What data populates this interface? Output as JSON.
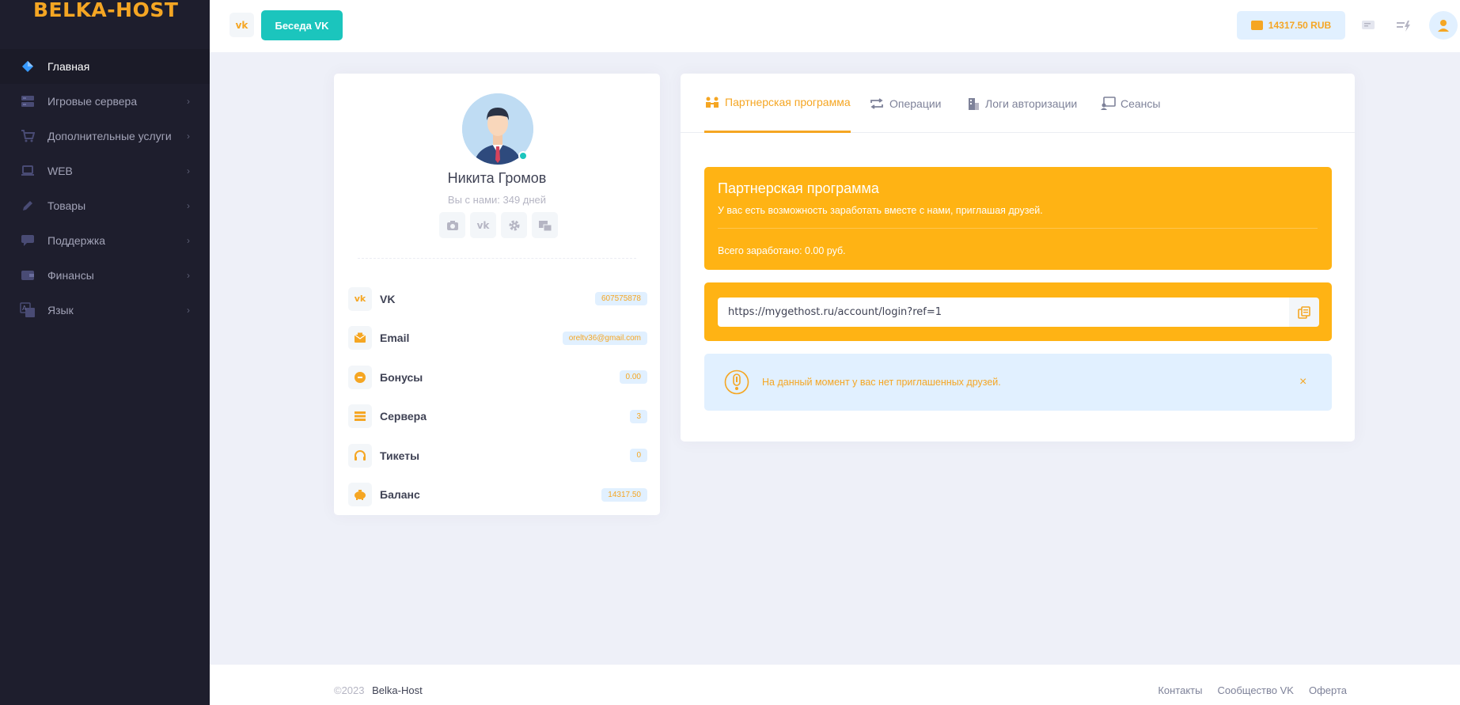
{
  "brand": {
    "logo": "BELKA-HOST"
  },
  "sidebar": {
    "items": [
      {
        "label": "Главная",
        "icon": "diamond-icon",
        "active": true
      },
      {
        "label": "Игровые сервера",
        "icon": "server-icon"
      },
      {
        "label": "Дополнительные услуги",
        "icon": "cart-icon"
      },
      {
        "label": "WEB",
        "icon": "laptop-icon"
      },
      {
        "label": "Товары",
        "icon": "pencil-icon"
      },
      {
        "label": "Поддержка",
        "icon": "chat-icon"
      },
      {
        "label": "Финансы",
        "icon": "wallet-icon"
      },
      {
        "label": "Язык",
        "icon": "translate-icon"
      }
    ]
  },
  "header": {
    "chat_button": "Беседа VK",
    "balance": "14317.50 RUB"
  },
  "profile": {
    "name": "Никита Громов",
    "since": "Вы с нами: 349 дней",
    "rows": [
      {
        "label": "VK",
        "value": "607575878",
        "icon": "vk-icon"
      },
      {
        "label": "Email",
        "value": "oreltv36@gmail.com",
        "icon": "email-icon"
      },
      {
        "label": "Бонусы",
        "value": "0.00",
        "icon": "bonus-icon"
      },
      {
        "label": "Сервера",
        "value": "3",
        "icon": "server-icon"
      },
      {
        "label": "Тикеты",
        "value": "0",
        "icon": "headset-icon"
      },
      {
        "label": "Баланс",
        "value": "14317.50",
        "icon": "piggy-bank-icon"
      }
    ]
  },
  "tabs": [
    {
      "label": "Партнерская программа",
      "icon": "partners-icon",
      "active": true
    },
    {
      "label": "Операции",
      "icon": "repeat-icon"
    },
    {
      "label": "Логи авторизации",
      "icon": "building-icon"
    },
    {
      "label": "Сеансы",
      "icon": "sessions-icon"
    }
  ],
  "partner": {
    "title": "Партнерская программа",
    "description": "У вас есть возможность заработать вместе с нами, приглашая друзей.",
    "earned": "Всего заработано: 0.00 руб.",
    "ref_link": "https://mygethost.ru/account/login?ref=1",
    "alert": "На данный момент у вас нет приглашенных друзей.",
    "alert_close": "×"
  },
  "footer": {
    "year": "©2023",
    "brand": "Belka-Host",
    "links": [
      "Контакты",
      "Сообщество VK",
      "Оферта"
    ]
  },
  "colors": {
    "accent": "#f5a623",
    "teal": "#1bc5bd",
    "sidebar": "#1e1e2d",
    "light_blue": "#e1f0ff"
  }
}
